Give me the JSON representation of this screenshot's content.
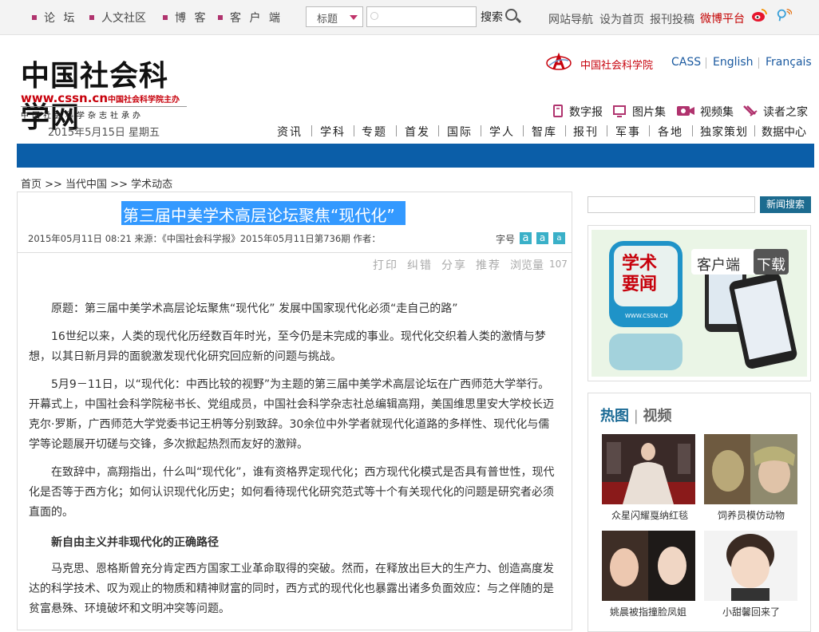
{
  "topbar": {
    "nav": [
      "论 坛",
      "人文社区",
      "博 客",
      "客 户 端"
    ],
    "search_select": "标题",
    "search_button": "搜索",
    "links": [
      "网站导航",
      "设为首页",
      "报刊投稿"
    ],
    "weibo": "微博平台"
  },
  "header": {
    "logo_main": "中国社会科学网",
    "logo_url": "www.cssn.cn",
    "logo_sponsor": "中国社会科学院主办",
    "logo_slogan": "中国社会科学杂志社承办",
    "date": "2015年5月15日  星期五",
    "cass_cn": "中国社会科学院",
    "langs": [
      "CASS",
      "English",
      "Français"
    ],
    "services": [
      "数字报",
      "图片集",
      "视频集",
      "读者之家"
    ],
    "main_nav": [
      "资讯",
      "学科",
      "专题",
      "首发",
      "国际",
      "学人",
      "智库",
      "报刊",
      "军事",
      "各地",
      "独家策划",
      "数据中心"
    ]
  },
  "breadcrumb": "首页 >> 当代中国 >> 学术动态",
  "article": {
    "title": "第三届中美学术高层论坛聚焦“现代化”",
    "meta": "2015年05月11日 08:21 来源：《中国社会科学报》2015年05月11日第736期 作者：",
    "font_label": "字号",
    "tools": [
      "打印",
      "纠错",
      "分享",
      "推荐",
      "浏览量"
    ],
    "views": "107",
    "paragraphs": [
      "原题：第三届中美学术高层论坛聚焦“现代化” 发展中国家现代化必须“走自己的路”",
      "16世纪以来，人类的现代化历经数百年时光，至今仍是未完成的事业。现代化交织着人类的激情与梦想，以其日新月异的面貌激发现代化研究回应新的问题与挑战。",
      "5月9－11日，以“现代化：中西比较的视野”为主题的第三届中美学术高层论坛在广西师范大学举行。开幕式上，中国社会科学院秘书长、党组成员，中国社会科学杂志社总编辑高翔，美国维思里安大学校长迈克尔·罗斯，广西师范大学党委书记王枬等分别致辞。30余位中外学者就现代化道路的多样性、现代化与儒学等论题展开切磋与交锋，多次掀起热烈而友好的激辩。",
      "在致辞中，高翔指出，什么叫“现代化”，谁有资格界定现代化；西方现代化模式是否具有普世性，现代化是否等于西方化；如何认识现代化历史；如何看待现代化研究范式等十个有关现代化的问题是研究者必须直面的。",
      "马克思、恩格斯曾充分肯定西方国家工业革命取得的突破。然而，在释放出巨大的生产力、创造高度发达的科学技术、叹为观止的物质和精神财富的同时，西方式的现代化也暴露出诸多负面效应：与之伴随的是贫富悬殊、环境破坏和文明冲突等问题。"
    ],
    "subhead": "新自由主义并非现代化的正确路径"
  },
  "sidebar": {
    "search_button": "新闻搜索",
    "ad": {
      "title": "学术要闻",
      "client": "客户端",
      "download": "下载",
      "url": "WWW.CSSN.CN"
    },
    "hot_title": "热图",
    "hot_video": "视频",
    "hot_items": [
      "众星闪耀戛纳红毯",
      "饲养员模仿动物",
      "姚晨被指撞脸凤姐",
      "小甜馨回来了"
    ]
  },
  "colors": {
    "accent_blue": "#0b5ea8",
    "brand_red": "#c7000b",
    "highlight": "#3399ff"
  }
}
